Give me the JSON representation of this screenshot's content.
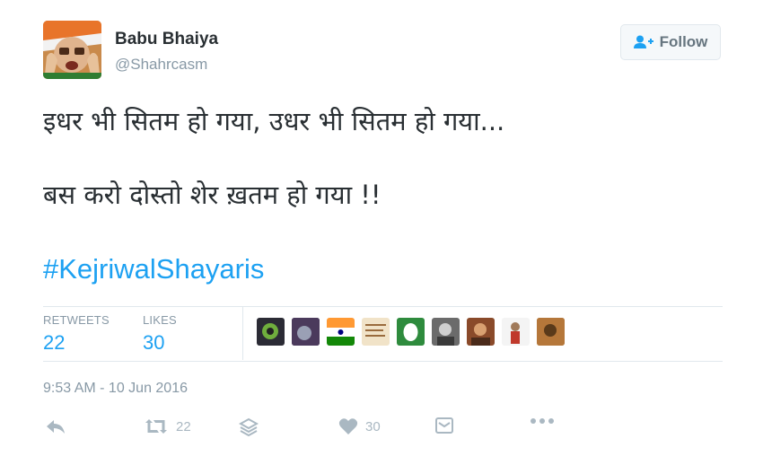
{
  "user": {
    "display_name": "Babu Bhaiya",
    "handle": "@Shahrcasm"
  },
  "follow_button": {
    "label": "Follow"
  },
  "tweet": {
    "line1": "इधर भी सितम हो गया, उधर भी सितम हो गया...",
    "line2": "बस करो दोस्तो शेर ख़तम हो गया !!",
    "hashtag": "#KejriwalShayaris"
  },
  "stats": {
    "retweets_label": "RETWEETS",
    "retweets_value": "22",
    "likes_label": "LIKES",
    "likes_value": "30"
  },
  "timestamp": "9:53 AM - 10 Jun 2016",
  "actions": {
    "retweet_count": "22",
    "like_count": "30"
  },
  "colors": {
    "link_blue": "#1da1f2",
    "muted_gray": "#8899a6",
    "icon_gray": "#aab8c2"
  },
  "icons": [
    "add-user-icon",
    "reply-icon",
    "retweet-icon",
    "layers-icon",
    "heart-icon",
    "media-icon",
    "more-icon"
  ]
}
